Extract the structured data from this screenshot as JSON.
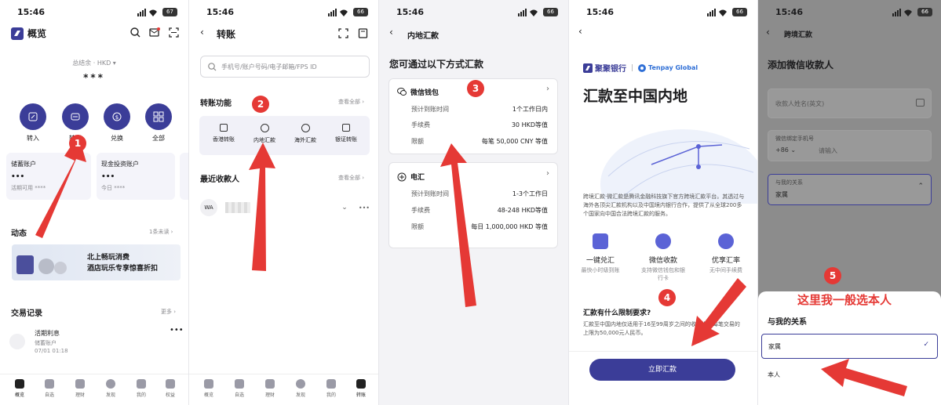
{
  "colors": {
    "primary": "#3b3d98",
    "annotation": "#e53935"
  },
  "p1": {
    "time": "15:46",
    "battery": "67",
    "title": "概览",
    "balance_label": "总结余 · HKD ▾",
    "balance_value": "***",
    "actions": [
      {
        "label": "转入",
        "icon": "transfer-in-icon"
      },
      {
        "label": "转账",
        "icon": "transfer-icon"
      },
      {
        "label": "兑换",
        "icon": "exchange-icon"
      },
      {
        "label": "全部",
        "icon": "grid-icon"
      }
    ],
    "account1": {
      "name": "储蓄账户",
      "value": "•••",
      "sub": "活期可用 ****"
    },
    "account2": {
      "name": "现金投资账户",
      "value": "•••",
      "sub": "今日 ****"
    },
    "news_title": "动态",
    "news_more": "1条未读 ›",
    "banner_line1": "北上畅玩消费",
    "banner_line2": "酒店玩乐专享惊喜折扣",
    "tx_title": "交易记录",
    "tx_more": "更多 ›",
    "tx_name": "活期利息",
    "tx_account": "储蓄账户",
    "tx_time": "07/01 01:18",
    "tabs": [
      "概览",
      "自选",
      "理财",
      "发现",
      "我的",
      "权益"
    ],
    "marker": "1"
  },
  "p2": {
    "time": "15:46",
    "battery": "66",
    "title": "转账",
    "search_placeholder": "手机号/账户号码/电子邮箱/FPS ID",
    "section_title": "转账功能",
    "section_more": "查看全部 ›",
    "functions": [
      "香港转账",
      "内地汇款",
      "海外汇款",
      "银证转账"
    ],
    "recent_title": "最近收款人",
    "recent_more": "查看全部 ›",
    "recent_avatar": "WA",
    "tabs": [
      "概览",
      "自选",
      "理财",
      "发现",
      "我的",
      "转账"
    ],
    "marker": "2"
  },
  "p3": {
    "time": "15:46",
    "battery": "66",
    "title": "内地汇款",
    "heading": "您可通过以下方式汇款",
    "wechat": {
      "name": "微信钱包",
      "rows": [
        [
          "预计到账时间",
          "1个工作日内"
        ],
        [
          "手续费",
          "30 HKD等值"
        ],
        [
          "限额",
          "每笔 50,000 CNY 等值"
        ]
      ]
    },
    "wire": {
      "name": "电汇",
      "rows": [
        [
          "预计到账时间",
          "1-3个工作日"
        ],
        [
          "手续费",
          "48-248 HKD等值"
        ],
        [
          "限额",
          "每日 1,000,000 HKD 等值"
        ]
      ]
    },
    "marker": "3"
  },
  "p4": {
    "time": "15:46",
    "battery": "66",
    "brand1": "聚聚银行",
    "brand2": "Tenpay Global",
    "heading": "汇款至中国内地",
    "desc": "跨境汇款·微汇款是腾讯金融科技旗下官方跨境汇款平台。其透过与海外各顶尖汇款机构以及中国境内银行合作，提供了从全球200多个国家向中国合法跨境汇款的服务。",
    "features": [
      {
        "title": "一键兑汇",
        "sub": "最快小时级到账"
      },
      {
        "title": "微信收款",
        "sub": "支持微信钱包和银行卡"
      },
      {
        "title": "优享汇率",
        "sub": "无中间手续费"
      }
    ],
    "limit_title": "汇款有什么限制要求?",
    "limit_desc": "汇款至中国内地仅适用于16至99周岁之间的收款人。每笔交易的上限为50,000元人民币。",
    "button": "立即汇款",
    "marker": "4"
  },
  "p5": {
    "time": "15:46",
    "battery": "66",
    "title": "跨境汇款",
    "heading": "添加微信收款人",
    "name_placeholder": "收款人姓名(英文)",
    "phone_label": "微信绑定手机号",
    "phone_code": "+86 ⌄",
    "phone_placeholder": "请输入",
    "relation_label": "与我的关系",
    "relation_value": "家属",
    "sheet_title": "与我的关系",
    "options": [
      "家属",
      "本人"
    ],
    "note": "这里我一般选本人",
    "marker": "5"
  }
}
